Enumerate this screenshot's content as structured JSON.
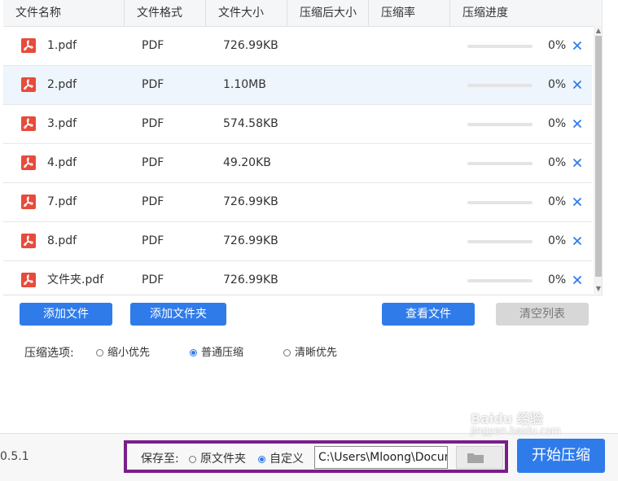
{
  "table": {
    "headers": [
      "文件名称",
      "文件格式",
      "文件大小",
      "压缩后大小",
      "压缩率",
      "压缩进度"
    ],
    "rows": [
      {
        "name": "1.pdf",
        "format": "PDF",
        "size": "726.99KB",
        "progress_text": "0%",
        "progress": 0
      },
      {
        "name": "2.pdf",
        "format": "PDF",
        "size": "1.10MB",
        "progress_text": "0%",
        "progress": 0
      },
      {
        "name": "3.pdf",
        "format": "PDF",
        "size": "574.58KB",
        "progress_text": "0%",
        "progress": 0
      },
      {
        "name": "4.pdf",
        "format": "PDF",
        "size": "49.20KB",
        "progress_text": "0%",
        "progress": 0
      },
      {
        "name": "7.pdf",
        "format": "PDF",
        "size": "726.99KB",
        "progress_text": "0%",
        "progress": 0
      },
      {
        "name": "8.pdf",
        "format": "PDF",
        "size": "726.99KB",
        "progress_text": "0%",
        "progress": 0
      },
      {
        "name": "文件夹.pdf",
        "format": "PDF",
        "size": "726.99KB",
        "progress_text": "0%",
        "progress": 0
      }
    ]
  },
  "actions": {
    "add_file": "添加文件",
    "add_folder": "添加文件夹",
    "view_files": "查看文件",
    "clear_list": "清空列表"
  },
  "compress_options": {
    "label": "压缩选项:",
    "options": [
      "缩小优先",
      "普通压缩",
      "清晰优先"
    ],
    "selected": "普通压缩"
  },
  "footer": {
    "version": "0.5.1",
    "save_label": "保存至:",
    "save_options": [
      "原文件夹",
      "自定义"
    ],
    "save_selected": "自定义",
    "path": "C:\\Users\\Mloong\\Docum",
    "start_button": "开始压缩"
  },
  "watermark": {
    "line1": "Baidu 经验",
    "line2": "jingyan.baidu.com"
  },
  "colors": {
    "accent": "#2f7bea",
    "pdf_icon": "#e64b3c",
    "highlight_box": "#7a1e8a"
  }
}
